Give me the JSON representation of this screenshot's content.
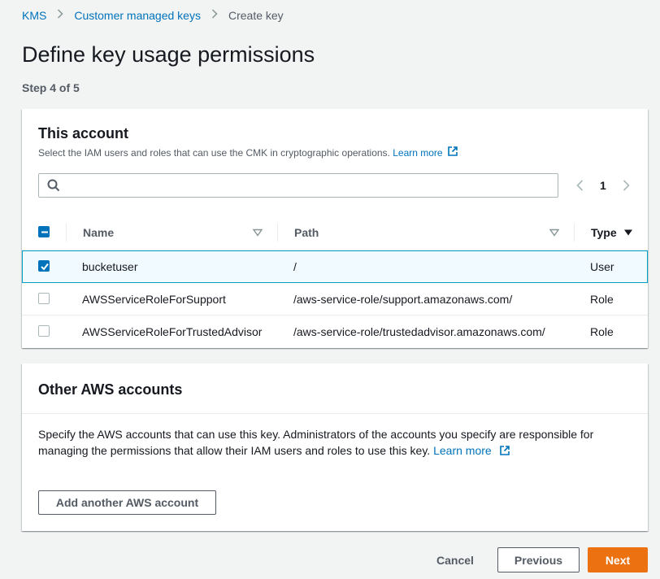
{
  "breadcrumb": {
    "items": [
      "KMS",
      "Customer managed keys"
    ],
    "current": "Create key"
  },
  "page": {
    "title": "Define key usage permissions",
    "step": "Step 4 of 5"
  },
  "this_account": {
    "title": "This account",
    "description": "Select the IAM users and roles that can use the CMK in cryptographic operations.",
    "learn_more": "Learn more",
    "search": {
      "value": "",
      "placeholder": ""
    },
    "pagination": {
      "current_page": "1"
    },
    "columns": {
      "name": "Name",
      "path": "Path",
      "type": "Type"
    },
    "rows": [
      {
        "name": "bucketuser",
        "path": "/",
        "type": "User",
        "selected": true
      },
      {
        "name": "AWSServiceRoleForSupport",
        "path": "/aws-service-role/support.amazonaws.com/",
        "type": "Role",
        "selected": false
      },
      {
        "name": "AWSServiceRoleForTrustedAdvisor",
        "path": "/aws-service-role/trustedadvisor.amazonaws.com/",
        "type": "Role",
        "selected": false
      }
    ]
  },
  "other_accounts": {
    "title": "Other AWS accounts",
    "description": "Specify the AWS accounts that can use this key. Administrators of the accounts you specify are responsible for managing the permissions that allow their IAM users and roles to use this key.",
    "learn_more": "Learn more",
    "add_button": "Add another AWS account"
  },
  "footer": {
    "cancel": "Cancel",
    "previous": "Previous",
    "next": "Next"
  },
  "colors": {
    "link": "#0073bb",
    "primary": "#ec7211",
    "selected_row_bg": "#f1faff",
    "selected_row_border": "#00a1c9"
  }
}
